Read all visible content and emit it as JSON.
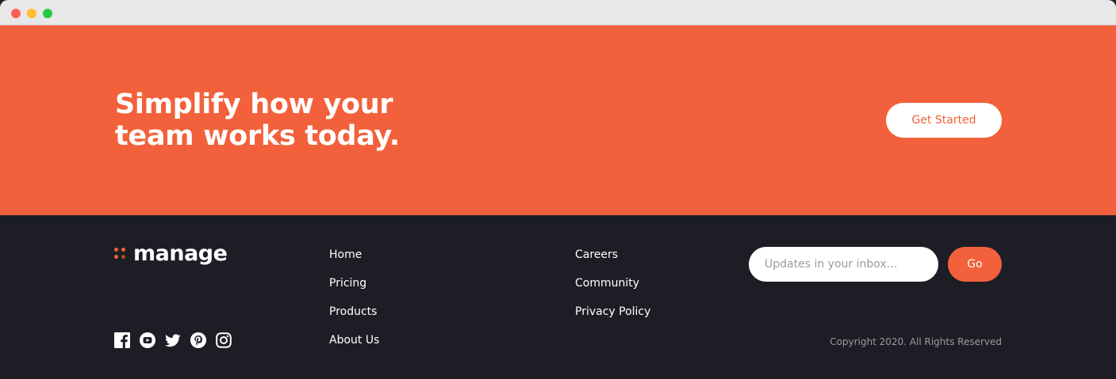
{
  "colors": {
    "accent": "#f2613b",
    "footer_bg": "#1d1e25",
    "text_light": "#ffffff",
    "text_muted": "#9a9ba0",
    "logo_dot_light": "#f2613b",
    "logo_dot_dark": "#b5462b"
  },
  "cta": {
    "heading": "Simplify how your team works today.",
    "button_label": "Get Started"
  },
  "footer": {
    "logo_text": "manage",
    "social_icons": [
      "facebook-icon",
      "youtube-icon",
      "twitter-icon",
      "pinterest-icon",
      "instagram-icon"
    ],
    "nav_col1": [
      "Home",
      "Pricing",
      "Products",
      "About Us"
    ],
    "nav_col2": [
      "Careers",
      "Community",
      "Privacy Policy"
    ],
    "newsletter": {
      "placeholder": "Updates in your inbox…",
      "button_label": "Go"
    },
    "copyright": "Copyright 2020. All Rights Reserved"
  }
}
